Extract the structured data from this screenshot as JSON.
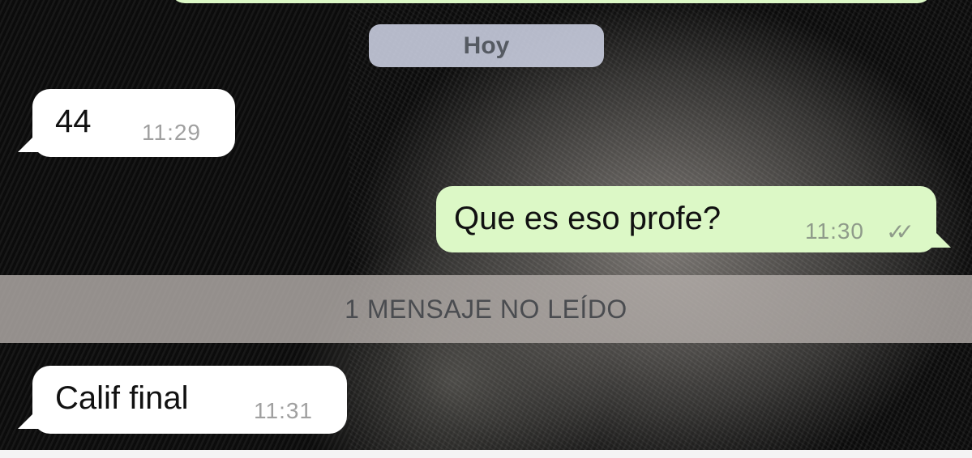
{
  "chat": {
    "date_divider": "Hoy",
    "unread_divider": "1 MENSAJE NO LEÍDO",
    "messages": [
      {
        "direction": "incoming",
        "text": "44",
        "time": "11:29"
      },
      {
        "direction": "outgoing",
        "text": "Que es eso profe?",
        "time": "11:30",
        "status_icon": "double-check-icon"
      },
      {
        "direction": "incoming",
        "text": "Calif final",
        "time": "11:31"
      }
    ]
  },
  "colors": {
    "incoming_bubble": "#ffffff",
    "outgoing_bubble": "#dcf8c6",
    "date_chip": "#cdd2e4",
    "unread_bar": "#b2aca8"
  }
}
